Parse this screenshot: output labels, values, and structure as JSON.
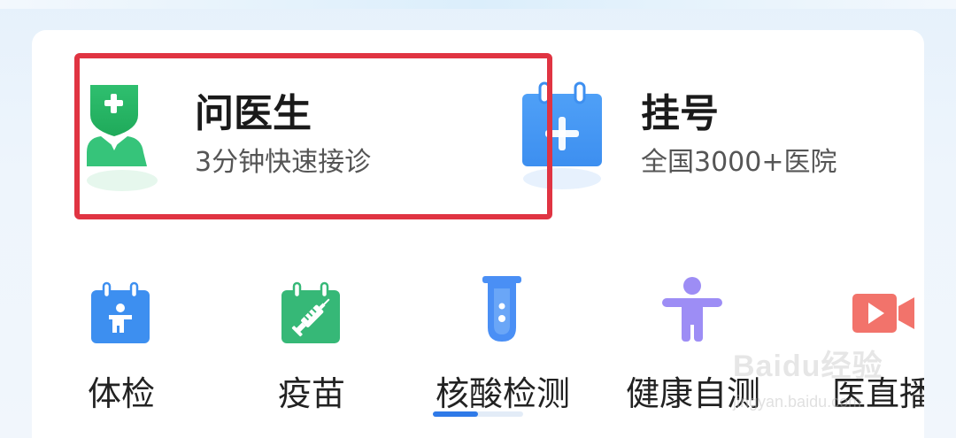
{
  "primary_features": [
    {
      "title": "问医生",
      "subtitle": "3分钟快速接诊"
    },
    {
      "title": "挂号",
      "subtitle": "全国3000+医院"
    }
  ],
  "shortcuts": [
    {
      "label": "体检",
      "icon": "physical-exam-icon"
    },
    {
      "label": "疫苗",
      "icon": "vaccine-icon"
    },
    {
      "label": "核酸检测",
      "icon": "test-tube-icon"
    },
    {
      "label": "健康自测",
      "icon": "person-icon"
    },
    {
      "label": "医直播",
      "icon": "video-icon"
    }
  ],
  "colors": {
    "highlight": "#e03442",
    "doctor_green": "#2fbf6f",
    "register_blue": "#3d8ff0",
    "vaccine_green": "#36b877",
    "test_tube_blue": "#4a8ff5",
    "person_purple": "#9d8df5",
    "video_red": "#f2736b",
    "pager_active": "#2f7ae8"
  },
  "pager": {
    "page": 1,
    "pages": 2
  },
  "watermark": {
    "brand": "Baidu经验",
    "url": "jingyan.baidu.com"
  }
}
